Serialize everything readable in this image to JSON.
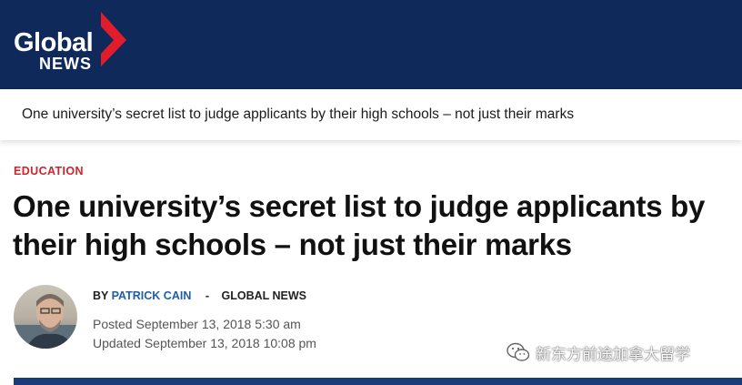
{
  "header": {
    "logo_word": "Global",
    "logo_sub": "NEWS",
    "bg_color": "#10295b",
    "logo_mark_color": "#e11d2b"
  },
  "subbar": {
    "title": "One university’s secret list to judge applicants by their high schools – not just their marks"
  },
  "article": {
    "category": "EDUCATION",
    "headline": "One university’s secret list to judge applicants by their high schools – not just their marks",
    "byline": {
      "by": "BY",
      "author": "PATRICK CAIN",
      "separator": "-",
      "source": "GLOBAL NEWS"
    },
    "posted": "Posted September 13, 2018 5:30 am",
    "updated": "Updated September 13, 2018 10:08 pm"
  },
  "watermark": {
    "icon": "wechat-icon",
    "text": "新东方前途加拿大留学"
  },
  "colors": {
    "category_red": "#d2232a",
    "author_blue": "#1f5fa8"
  }
}
